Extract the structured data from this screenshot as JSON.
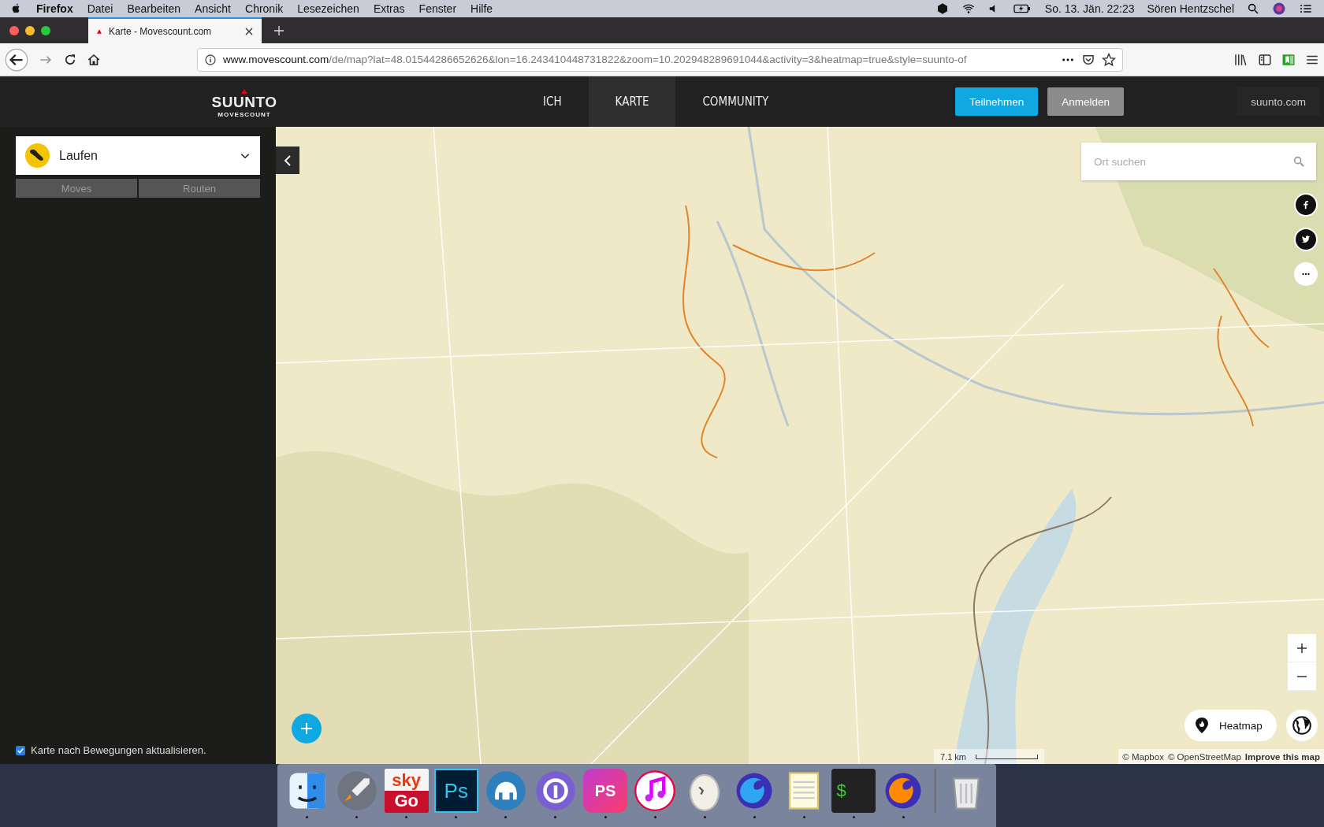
{
  "menubar": {
    "app": "Firefox",
    "menus": [
      "Datei",
      "Bearbeiten",
      "Ansicht",
      "Chronik",
      "Lesezeichen",
      "Extras",
      "Fenster",
      "Hilfe"
    ],
    "clock": "So. 13. Jän.  22:23",
    "user": "Sören Hentzschel"
  },
  "browser": {
    "tabs": [
      {
        "title": "Karte - Movescount.com",
        "selected": true
      }
    ],
    "url_host": "www.movescount.com",
    "url_rest": "/de/map?lat=48.01544286652626&lon=16.243410448731822&zoom=10.202948289691044&activity=3&heatmap=true&style=suunto-of"
  },
  "site": {
    "logo": "SUUNTO",
    "logo_sub": "MOVESCOUNT",
    "nav": [
      {
        "label": "ICH",
        "selected": false
      },
      {
        "label": "KARTE",
        "selected": true
      },
      {
        "label": "COMMUNITY",
        "selected": false
      }
    ],
    "join": "Teilnehmen",
    "login": "Anmelden",
    "external": "suunto.com"
  },
  "sidebar": {
    "activity": "Laufen",
    "tabs": [
      {
        "label": "Moves",
        "selected": false
      },
      {
        "label": "Routen",
        "selected": false
      }
    ],
    "update_option": {
      "label": "Karte nach Bewegungen aktualisieren.",
      "checked": true
    }
  },
  "map": {
    "search": {
      "placeholder": "Ort suchen"
    },
    "heatmap": "Heatmap",
    "scale": "7.1 km",
    "attribution": [
      {
        "kind": "plain",
        "text": "© Mapbox"
      },
      {
        "kind": "plain",
        "text": "© OpenStreetMap"
      },
      {
        "kind": "link",
        "text": "Improve this map"
      }
    ]
  },
  "dock": [
    {
      "kind": "finder",
      "running": true
    },
    {
      "kind": "rocket",
      "running": true
    },
    {
      "kind": "sky",
      "label": "sky",
      "label2": "Go",
      "running": true
    },
    {
      "kind": "ps",
      "label": "Ps",
      "running": true
    },
    {
      "kind": "elephant",
      "running": true
    },
    {
      "kind": "key",
      "running": true
    },
    {
      "kind": "storm",
      "label": "PS",
      "running": true
    },
    {
      "kind": "music",
      "running": true
    },
    {
      "kind": "egg",
      "running": true
    },
    {
      "kind": "fox",
      "running": true
    },
    {
      "kind": "notes",
      "running": true
    },
    {
      "kind": "terminal",
      "label": "$",
      "running": true
    },
    {
      "kind": "fox2",
      "running": true
    },
    {
      "kind": "sep"
    },
    {
      "kind": "trash"
    }
  ]
}
